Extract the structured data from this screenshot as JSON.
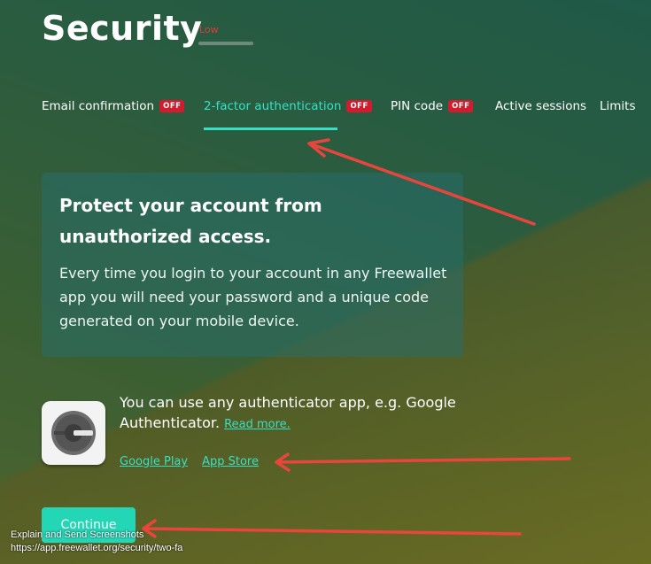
{
  "page": {
    "title": "Security",
    "level": "Low"
  },
  "tabs": [
    {
      "label": "Email confirmation",
      "badge": "OFF"
    },
    {
      "label": "2-factor authentication",
      "badge": "OFF"
    },
    {
      "label": "PIN code",
      "badge": "OFF"
    },
    {
      "label": "Active sessions"
    },
    {
      "label": "Limits"
    }
  ],
  "card": {
    "heading": "Protect your account from unauthorized access.",
    "body": "Every time you login to your account in any Freewallet app you will need your password and a unique code generated on your mobile device."
  },
  "authenticator": {
    "text": "You can use any authenticator app, e.g. Google Authenticator.",
    "read_more": "Read more.",
    "google_play": "Google Play",
    "app_store": "App Store"
  },
  "continue_label": "Continue",
  "extension": {
    "name": "Explain and Send Screenshots",
    "url": "https://app.freewallet.org/security/two-fa"
  },
  "colors": {
    "accent": "#37e0c4",
    "badge": "#d11c2e",
    "annotation_arrow": "#e8453c"
  }
}
